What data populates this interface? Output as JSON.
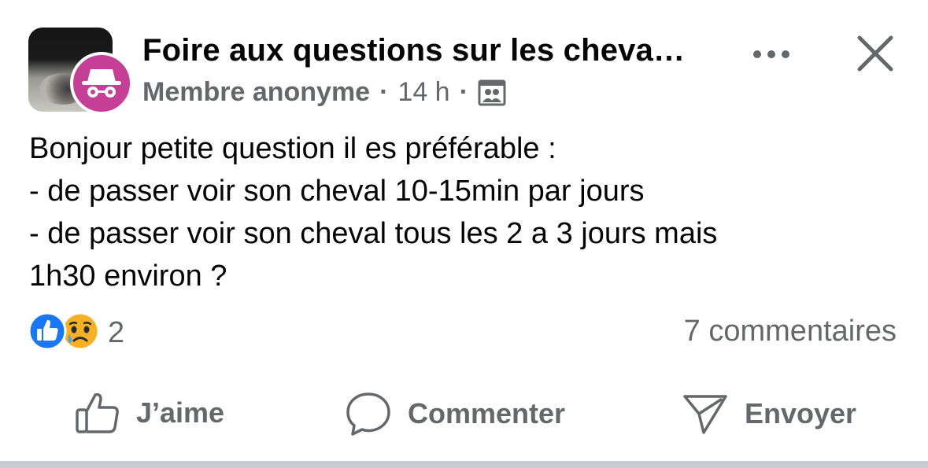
{
  "post": {
    "group_title": "Foire aux questions sur les cheva…",
    "author": "Membre anonyme",
    "time": "14 h",
    "separator": "·",
    "audience_icon": "group-audience-icon",
    "body": "Bonjour petite question il es préférable :\n- de passer voir son cheval 10-15min par jours\n- de passer voir son cheval tous les 2 a 3 jours mais\n1h30 environ ?",
    "reactions": {
      "types": [
        "like",
        "sad"
      ],
      "count": "2"
    },
    "comments_label": "7 commentaires"
  },
  "actions": {
    "like_label": "J’aime",
    "comment_label": "Commenter",
    "send_label": "Envoyer"
  },
  "colors": {
    "secondary_text": "#65676b",
    "primary_text": "#050505",
    "anon_avatar_bg": "#c53f97",
    "like_blue": "#1877f2",
    "sad_yellow": "#f7b125"
  }
}
